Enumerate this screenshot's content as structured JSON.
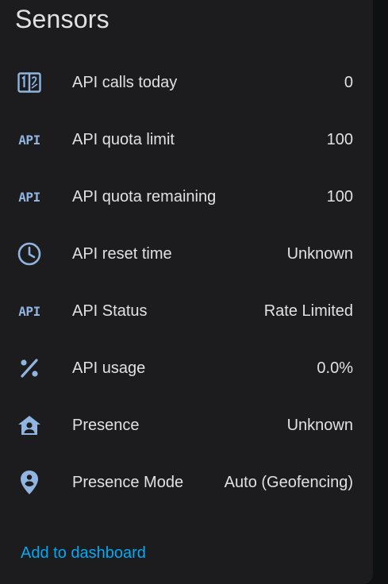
{
  "card": {
    "title": "Sensors",
    "footer_link": "Add to dashboard"
  },
  "rows": [
    {
      "icon": "counter-icon",
      "label": "API calls today",
      "value": "0"
    },
    {
      "icon": "api-icon",
      "label": "API quota limit",
      "value": "100"
    },
    {
      "icon": "api-icon",
      "label": "API quota remaining",
      "value": "100"
    },
    {
      "icon": "clock-icon",
      "label": "API reset time",
      "value": "Unknown"
    },
    {
      "icon": "api-icon",
      "label": "API Status",
      "value": "Rate Limited"
    },
    {
      "icon": "percent-icon",
      "label": "API usage",
      "value": "0.0%"
    },
    {
      "icon": "home-account-icon",
      "label": "Presence",
      "value": "Unknown"
    },
    {
      "icon": "map-marker-account-icon",
      "label": "Presence Mode",
      "value": "Auto (Geofencing)"
    }
  ],
  "api_icon_text": "API",
  "colors": {
    "icon": "#8fb5e0",
    "text": "#e1e1e1",
    "link": "#03a9f4",
    "card_bg": "#1c1c1e"
  }
}
